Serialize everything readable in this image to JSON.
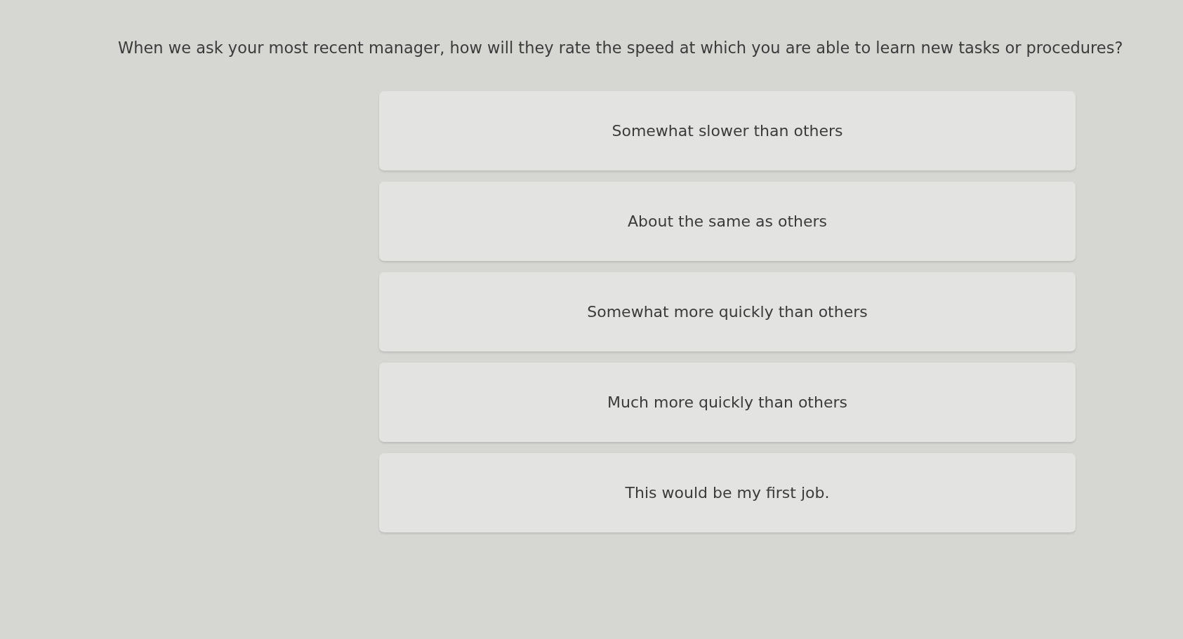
{
  "question": {
    "text": "When we ask your most recent manager, how will they rate the speed at which you are able to learn new tasks or procedures?"
  },
  "options": [
    {
      "label": "Somewhat slower than others",
      "selected": false
    },
    {
      "label": "About the same as others",
      "selected": false
    },
    {
      "label": "Somewhat more quickly than others",
      "selected": false
    },
    {
      "label": "Much more quickly than others",
      "selected": false
    },
    {
      "label": "This would be my first job.",
      "selected": false
    }
  ]
}
